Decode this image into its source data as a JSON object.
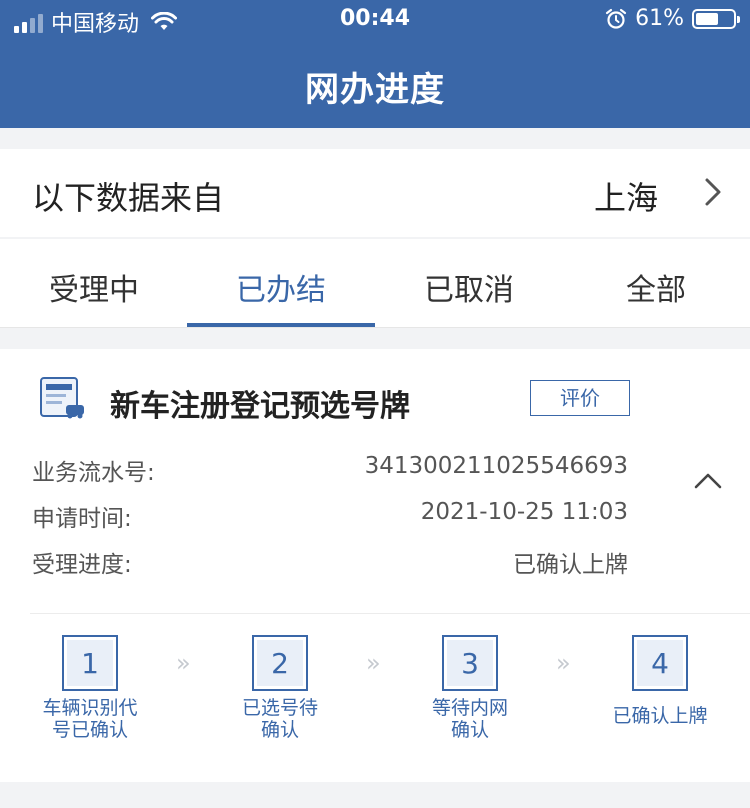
{
  "status_bar": {
    "carrier": "中国移动",
    "time": "00:44",
    "battery": "61%"
  },
  "header": {
    "title": "网办进度"
  },
  "source": {
    "label": "以下数据来自",
    "city": "上海"
  },
  "tabs": [
    {
      "label": "受理中"
    },
    {
      "label": "已办结",
      "active": true
    },
    {
      "label": "已取消"
    },
    {
      "label": "全部"
    }
  ],
  "record": {
    "title": "新车注册登记预选号牌",
    "rate_label": "评价",
    "fields": [
      {
        "key": "业务流水号:",
        "value": "341300211025546693"
      },
      {
        "key": "申请时间:",
        "value": "2021-10-25 11:03"
      },
      {
        "key": "受理进度:",
        "value": "已确认上牌"
      }
    ],
    "steps": [
      {
        "num": "1",
        "line1": "车辆识别代",
        "line2": "号已确认"
      },
      {
        "num": "2",
        "line1": "已选号待",
        "line2": "确认"
      },
      {
        "num": "3",
        "line1": "等待内网",
        "line2": "确认"
      },
      {
        "num": "4",
        "line1": "已确认上牌",
        "line2": ""
      }
    ],
    "step_separator": "»"
  },
  "colors": {
    "primary": "#3a67a8",
    "background": "#f2f3f5"
  }
}
